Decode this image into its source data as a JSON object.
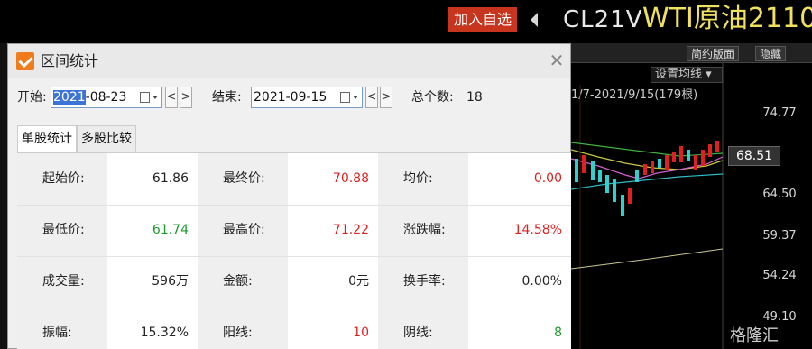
{
  "header": {
    "add_favorite": "加入自选",
    "code": "CL21V",
    "name": "WTI原油2110"
  },
  "chart": {
    "toolbar": [
      "简约版面",
      "隐藏"
    ],
    "ma_button": "设置均线",
    "range_text": "1/7-2021/9/15(179根)",
    "price_ticks": [
      "74.77",
      "64.50",
      "59.37",
      "54.24",
      "49.10"
    ],
    "current_price": "68.51",
    "watermark": "格隆汇"
  },
  "dialog": {
    "title": "区间统计",
    "start_label": "开始:",
    "start_date_sel": "2021",
    "start_date_rest": "-08-23",
    "end_label": "结束:",
    "end_date": "2021-09-15",
    "prev": "<",
    "next": ">",
    "count_label": "总个数:",
    "count_value": "18",
    "tabs": [
      "单股统计",
      "多股比较"
    ],
    "rows": [
      [
        {
          "label": "起始价:",
          "value": "61.86",
          "color": "#222222"
        },
        {
          "label": "最终价:",
          "value": "70.88",
          "color": "#e02020"
        },
        {
          "label": "均价:",
          "value": "0.00",
          "color": "#e02020"
        }
      ],
      [
        {
          "label": "最低价:",
          "value": "61.74",
          "color": "#1f9a2e"
        },
        {
          "label": "最高价:",
          "value": "71.22",
          "color": "#e02020"
        },
        {
          "label": "涨跌幅:",
          "value": "14.58%",
          "color": "#e02020"
        }
      ],
      [
        {
          "label": "成交量:",
          "value": "596万",
          "color": "#222222"
        },
        {
          "label": "金额:",
          "value": "0元",
          "color": "#222222"
        },
        {
          "label": "换手率:",
          "value": "0.00%",
          "color": "#222222"
        }
      ],
      [
        {
          "label": "振幅:",
          "value": "15.32%",
          "color": "#222222"
        },
        {
          "label": "阳线:",
          "value": "10",
          "color": "#e02020"
        },
        {
          "label": "阴线:",
          "value": "8",
          "color": "#1f9a2e"
        }
      ]
    ]
  }
}
